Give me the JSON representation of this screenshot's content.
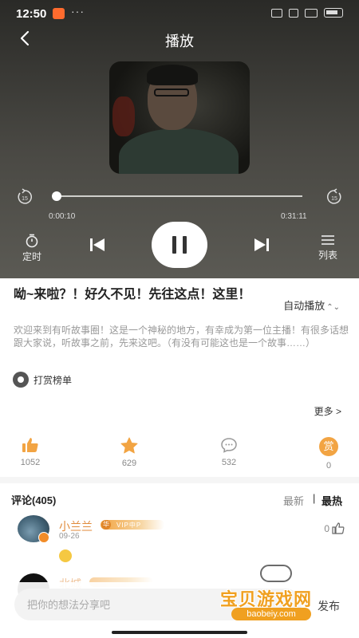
{
  "status_bar": {
    "time": "12:50",
    "dots": "···"
  },
  "header": {
    "title": "播放"
  },
  "player": {
    "current_time": "0:00:10",
    "total_time": "0:31:11",
    "progress_fraction": 0.005,
    "skip_back_seconds": "15",
    "skip_forward_seconds": "15",
    "timer_label": "定时",
    "list_label": "列表",
    "state": "playing"
  },
  "episode": {
    "title": "呦~来啦？！好久不见！先往这点！这里！",
    "autoplay_label": "自动播放",
    "autoplay_chevron": "⌃⌄",
    "description": "欢迎来到有听故事圈！这是一个神秘的地方，有幸成为第一位主播！有很多话想跟大家说，听故事之前，先来这吧。（有没有可能这也是一个故事……）",
    "reward_rank_label": "打赏榜单",
    "more_label": "更多 >"
  },
  "stats": {
    "likes": "1052",
    "favorites": "629",
    "comments": "532",
    "rewards": "0",
    "reward_char": "赏"
  },
  "comments_section": {
    "title": "评论(405)",
    "sort_newest": "最新",
    "sort_separator": "|",
    "sort_hot": "最热",
    "items": [
      {
        "user": "小兰兰",
        "level_char": "华",
        "vip": "VIP中P",
        "date": "09-26",
        "likes": "0"
      },
      {
        "user": "北城",
        "level_char": "华",
        "vip": "VIP中P"
      }
    ]
  },
  "composer": {
    "placeholder": "把你的想法分享吧",
    "publish_label": "发布"
  },
  "watermark": {
    "brand": "宝贝游戏网",
    "url": "baobeiy.com"
  },
  "colors": {
    "accent": "#f2a443",
    "username": "#e08a3a",
    "player_bg": "#4a4944"
  }
}
